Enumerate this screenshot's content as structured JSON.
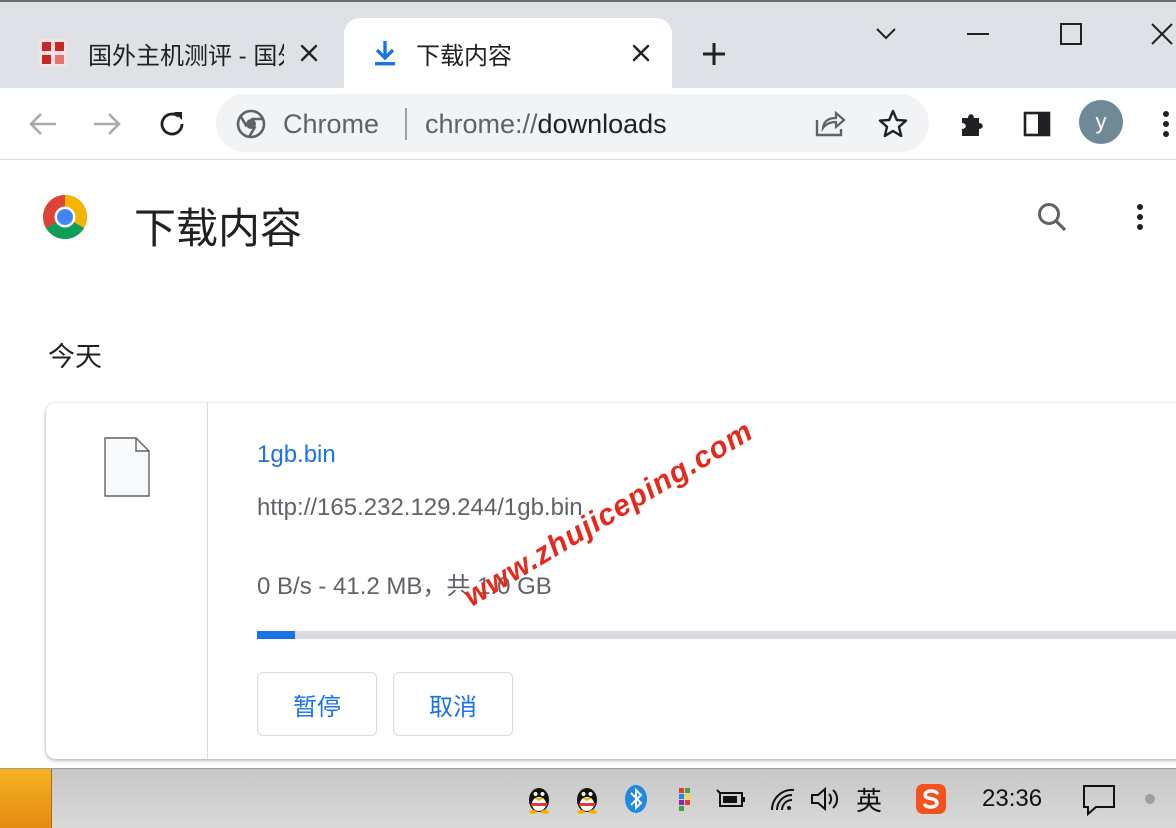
{
  "tabs": [
    {
      "title": "国外主机测评 - 国外",
      "active": false
    },
    {
      "title": "下载内容",
      "active": true
    }
  ],
  "window_controls": [
    "chevron-down",
    "minimize",
    "maximize",
    "close"
  ],
  "omnibox": {
    "site_label": "Chrome",
    "scheme": "chrome://",
    "host": "downloads"
  },
  "avatar_letter": "y",
  "page": {
    "title": "下载内容",
    "date_header": "今天"
  },
  "download": {
    "file_name": "1gb.bin",
    "url": "http://165.232.129.244/1gb.bin",
    "status": "0 B/s - 41.2 MB，共 1.0 GB",
    "progress": 0.04,
    "pause_label": "暂停",
    "cancel_label": "取消"
  },
  "watermark": "www.zhujiceping.com",
  "taskbar": {
    "ime": "英",
    "clock": "23:36"
  },
  "colors": {
    "accent": "#1a73e8",
    "tabstrip": "#dee1e6",
    "watermark": "#e32a1d"
  }
}
